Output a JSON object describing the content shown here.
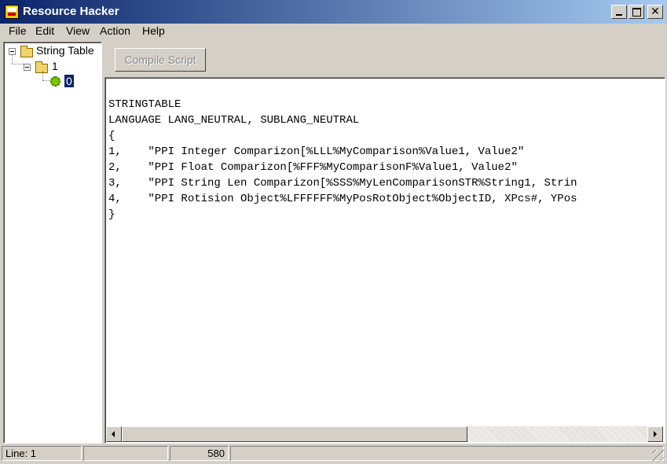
{
  "window": {
    "title": "Resource Hacker"
  },
  "menu": {
    "items": [
      "File",
      "Edit",
      "View",
      "Action",
      "Help"
    ]
  },
  "tree": {
    "root_label": "String Table",
    "child_label": "1",
    "leaf_label": "0"
  },
  "toolbar": {
    "compile_label": "Compile Script"
  },
  "editor": {
    "lines": [
      "STRINGTABLE",
      "LANGUAGE LANG_NEUTRAL, SUBLANG_NEUTRAL",
      "{",
      "1,    \"PPI Integer Comparizon[%LLL%MyComparison%Value1, Value2\"",
      "2,    \"PPI Float Comparizon[%FFF%MyComparisonF%Value1, Value2\"",
      "3,    \"PPI String Len Comparizon[%SSS%MyLenComparisonSTR%String1, Strin",
      "4,    \"PPI Rotision Object%LFFFFFF%MyPosRotObject%ObjectID, XPcs#, YPos",
      "}"
    ]
  },
  "status": {
    "line": "Line: 1",
    "panel2": "",
    "count": "580",
    "panel4": ""
  }
}
